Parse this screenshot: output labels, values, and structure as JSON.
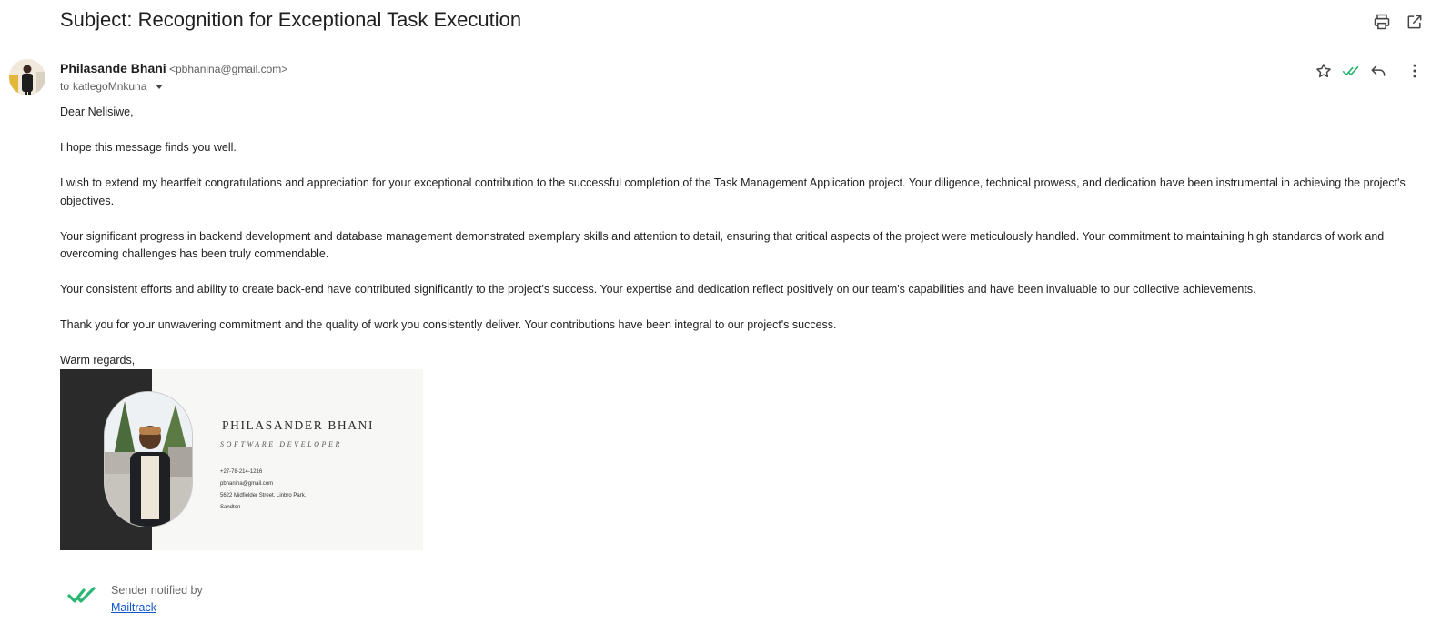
{
  "email": {
    "subject": "Subject: Recognition for Exceptional Task Execution",
    "sender_name": "Philasande Bhani",
    "sender_email": "<pbhanina@gmail.com>",
    "recipient_prefix": "to",
    "recipient": "katlegoMnkuna"
  },
  "body": {
    "greeting": "Dear Nelisiwe,",
    "paragraphs": [
      "I hope this message finds you well.",
      "I wish to extend my heartfelt congratulations and appreciation for your exceptional contribution to the successful completion of the Task Management Application project. Your diligence, technical prowess, and dedication have been instrumental in achieving the project's objectives.",
      "Your significant progress in backend development and database management demonstrated exemplary skills and attention to detail, ensuring that critical aspects of the project were meticulously handled. Your commitment to maintaining high standards of work and overcoming challenges has been truly commendable.",
      "Your consistent efforts and ability to create back-end have contributed significantly to the project's success. Your expertise and dedication reflect positively on our team's capabilities and have been invaluable to our collective achievements.",
      "Thank you for your unwavering commitment and the quality of work you consistently deliver. Your contributions have been integral to our project's success."
    ],
    "closing": "Warm regards,"
  },
  "signature": {
    "name": "PHILASANDER BHANI",
    "title": "SOFTWARE DEVELOPER",
    "phone": "+27-78-214-1216",
    "email": "pbhanina@gmail.com",
    "address_line1": "5622 Midfielder Street, Linbro Park,",
    "address_line2": "Sandton"
  },
  "mailtrack": {
    "text": "Sender notified by",
    "link": "Mailtrack"
  },
  "icons": {
    "print": "print-icon",
    "open_new_window": "open-in-new-window-icon",
    "star": "star-icon",
    "read_receipt": "double-check-icon",
    "reply": "reply-icon",
    "more": "more-vertical-icon"
  },
  "colors": {
    "check_green": "#2bb673",
    "link_blue": "#1155cc"
  }
}
